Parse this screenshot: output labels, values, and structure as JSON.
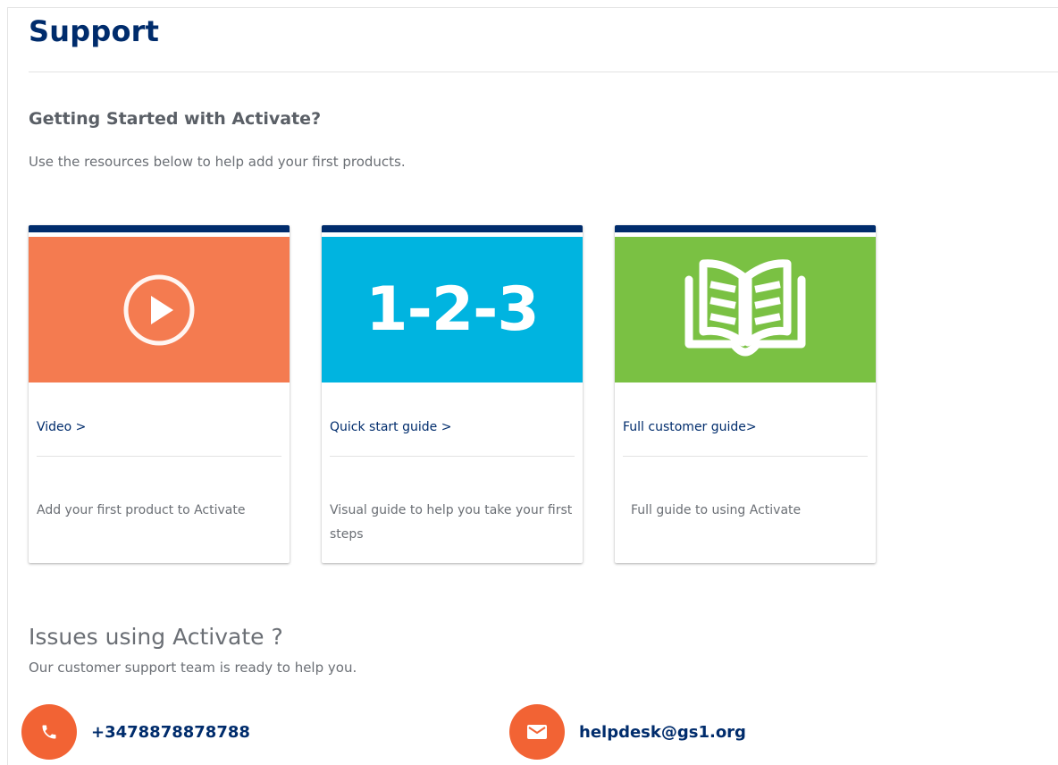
{
  "page": {
    "title": "Support"
  },
  "getting_started": {
    "heading": "Getting Started with Activate?",
    "subtext": "Use the resources below to help add your first products."
  },
  "cards": [
    {
      "icon": "play-icon",
      "image_color": "#f47b50",
      "link_label": "Video >",
      "description": "Add your first product to Activate"
    },
    {
      "icon": "steps-123-icon",
      "image_color": "#00b4e0",
      "image_text": "1-2-3",
      "link_label": "Quick start guide >",
      "description": "Visual guide to help you take your first steps"
    },
    {
      "icon": "open-book-icon",
      "image_color": "#7ac143",
      "link_label": "Full customer guide>",
      "description": "Full guide to using Activate"
    }
  ],
  "issues": {
    "heading": "Issues using Activate ?",
    "subtext": "Our customer support team is ready to help you."
  },
  "contacts": {
    "phone": {
      "icon": "phone-icon",
      "value": "+3478878878788"
    },
    "email": {
      "icon": "mail-icon",
      "value": "helpdesk@gs1.org"
    }
  },
  "colors": {
    "brand_navy": "#002c6c",
    "accent_orange": "#f26334"
  }
}
